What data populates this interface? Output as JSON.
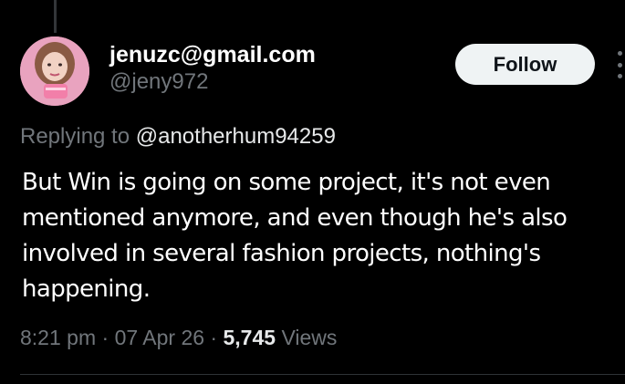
{
  "author": {
    "display_name": "jenuzc@gmail.com",
    "handle": "@jeny972",
    "avatar_icon": "profile-photo"
  },
  "follow_button": {
    "label": "Follow"
  },
  "more_icon": "more-options-icon",
  "reply": {
    "prefix": "Replying to",
    "target": "@anotherhum94259"
  },
  "tweet": {
    "text": "But Win is going on some project, it's not even mentioned anymore, and even though he's also involved in several fashion projects, nothing's happening."
  },
  "meta": {
    "time": "8:21 pm",
    "separator": "·",
    "date": "07 Apr 26",
    "views_count": "5,745",
    "views_label": "Views"
  },
  "colors": {
    "background": "#000000",
    "text_primary": "#ffffff",
    "text_secondary": "#71767b",
    "follow_bg": "#eff3f4",
    "follow_text": "#0f1419",
    "divider": "#2f3336"
  }
}
